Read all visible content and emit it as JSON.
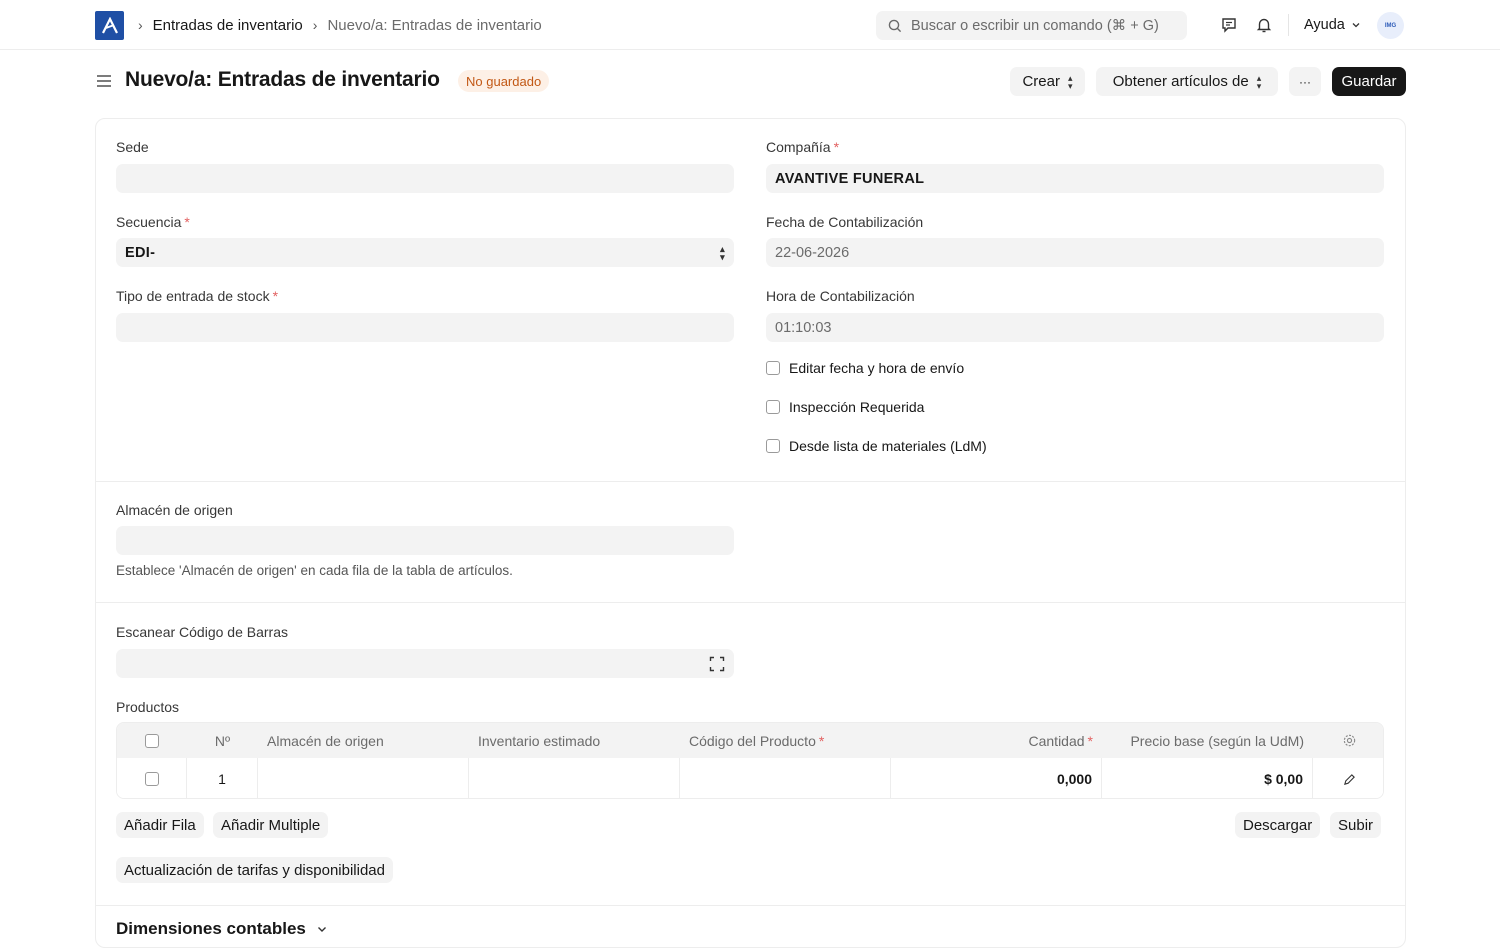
{
  "navbar": {
    "breadcrumbs": [
      "Entradas de inventario",
      "Nuevo/a: Entradas de inventario"
    ],
    "search_placeholder": "Buscar o escribir un comando (⌘ + G)",
    "help_label": "Ayuda",
    "avatar_text": "IMG"
  },
  "header": {
    "title": "Nuevo/a: Entradas de inventario",
    "status_badge": "No guardado",
    "create_label": "Crear",
    "get_items_label": "Obtener artículos de",
    "more_label": "···",
    "save_label": "Guardar"
  },
  "form": {
    "sede": {
      "label": "Sede",
      "value": ""
    },
    "compania": {
      "label": "Compañía",
      "value": "AVANTIVE FUNERAL"
    },
    "secuencia": {
      "label": "Secuencia",
      "value": "EDI-"
    },
    "fecha": {
      "label": "Fecha de Contabilización",
      "value": "22-06-2026"
    },
    "tipo": {
      "label": "Tipo de entrada de stock",
      "value": ""
    },
    "hora": {
      "label": "Hora de Contabilización",
      "value": "01:10:03"
    },
    "checkboxes": [
      {
        "label": "Editar fecha y hora de envío",
        "checked": false
      },
      {
        "label": "Inspección Requerida",
        "checked": false
      },
      {
        "label": "Desde lista de materiales (LdM)",
        "checked": false
      }
    ],
    "almacen": {
      "label": "Almacén de origen",
      "value": "",
      "help": "Establece 'Almacén de origen' en cada fila de la tabla de artículos."
    },
    "barcode": {
      "label": "Escanear Código de Barras",
      "value": ""
    }
  },
  "productos": {
    "label": "Productos",
    "columns": [
      "Nº",
      "Almacén de origen",
      "Inventario estimado",
      "Código del Producto",
      "Cantidad",
      "Precio base (según la UdM)"
    ],
    "rows": [
      {
        "no": "1",
        "almacen": "",
        "inventario": "",
        "codigo": "",
        "cantidad": "0,000",
        "precio": "$ 0,00"
      }
    ],
    "add_row_label": "Añadir Fila",
    "add_multiple_label": "Añadir Multiple",
    "download_label": "Descargar",
    "upload_label": "Subir",
    "update_rates_label": "Actualización de tarifas y disponibilidad"
  },
  "dimensiones": {
    "title": "Dimensiones contables"
  },
  "colors": {
    "primary": "#171717",
    "logo": "#1f4fa5",
    "required": "#e26060",
    "badge_bg": "#fdf0e6",
    "badge_text": "#c25815"
  }
}
